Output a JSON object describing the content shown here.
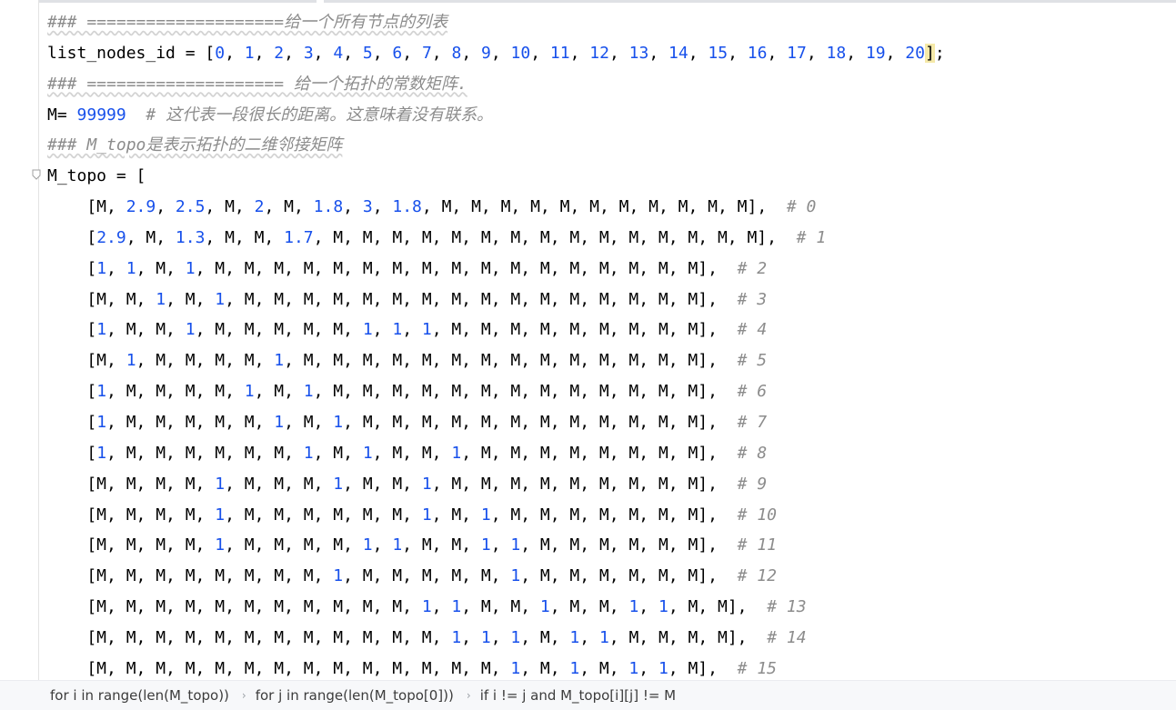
{
  "code_lines": [
    [
      {
        "t": "### ====================给一个所有节点的列表",
        "c": "comment"
      }
    ],
    [
      {
        "t": "list_nodes_id = ["
      },
      {
        "t": "0",
        "c": "num"
      },
      {
        "t": ", "
      },
      {
        "t": "1",
        "c": "num"
      },
      {
        "t": ", "
      },
      {
        "t": "2",
        "c": "num"
      },
      {
        "t": ", "
      },
      {
        "t": "3",
        "c": "num"
      },
      {
        "t": ", "
      },
      {
        "t": "4",
        "c": "num"
      },
      {
        "t": ", "
      },
      {
        "t": "5",
        "c": "num"
      },
      {
        "t": ", "
      },
      {
        "t": "6",
        "c": "num"
      },
      {
        "t": ", "
      },
      {
        "t": "7",
        "c": "num"
      },
      {
        "t": ", "
      },
      {
        "t": "8",
        "c": "num"
      },
      {
        "t": ", "
      },
      {
        "t": "9",
        "c": "num"
      },
      {
        "t": ", "
      },
      {
        "t": "10",
        "c": "num"
      },
      {
        "t": ", "
      },
      {
        "t": "11",
        "c": "num"
      },
      {
        "t": ", "
      },
      {
        "t": "12",
        "c": "num"
      },
      {
        "t": ", "
      },
      {
        "t": "13",
        "c": "num"
      },
      {
        "t": ", "
      },
      {
        "t": "14",
        "c": "num"
      },
      {
        "t": ", "
      },
      {
        "t": "15",
        "c": "num"
      },
      {
        "t": ", "
      },
      {
        "t": "16",
        "c": "num"
      },
      {
        "t": ", "
      },
      {
        "t": "17",
        "c": "num"
      },
      {
        "t": ", "
      },
      {
        "t": "18",
        "c": "num"
      },
      {
        "t": ", "
      },
      {
        "t": "19",
        "c": "num"
      },
      {
        "t": ", "
      },
      {
        "t": "20",
        "c": "num"
      },
      {
        "t": "]",
        "c": "bracket-hl"
      },
      {
        "t": ";"
      }
    ],
    [
      {
        "t": "### ==================== 给一个拓扑的常数矩阵.",
        "c": "comment"
      }
    ],
    [
      {
        "t": "M= "
      },
      {
        "t": "99999",
        "c": "num"
      },
      {
        "t": "  "
      },
      {
        "t": "# 这代表一段很长的距离。这意味着没有联系。",
        "c": "comment"
      }
    ],
    [
      {
        "t": "### M_topo是表示拓扑的二维邻接矩阵",
        "c": "comment"
      }
    ],
    [
      {
        "t": "M_topo = ["
      }
    ],
    [
      {
        "t": "    [M, "
      },
      {
        "t": "2.9",
        "c": "num"
      },
      {
        "t": ", "
      },
      {
        "t": "2.5",
        "c": "num"
      },
      {
        "t": ", M, "
      },
      {
        "t": "2",
        "c": "num"
      },
      {
        "t": ", M, "
      },
      {
        "t": "1.8",
        "c": "num"
      },
      {
        "t": ", "
      },
      {
        "t": "3",
        "c": "num"
      },
      {
        "t": ", "
      },
      {
        "t": "1.8",
        "c": "num"
      },
      {
        "t": ", M, M, M, M, M, M, M, M, M, M, M],  "
      },
      {
        "t": "# 0",
        "c": "comment"
      }
    ],
    [
      {
        "t": "    ["
      },
      {
        "t": "2.9",
        "c": "num"
      },
      {
        "t": ", M, "
      },
      {
        "t": "1.3",
        "c": "num"
      },
      {
        "t": ", M, M, "
      },
      {
        "t": "1.7",
        "c": "num"
      },
      {
        "t": ", M, M, M, M, M, M, M, M, M, M, M, M, M, M, M],  "
      },
      {
        "t": "# 1",
        "c": "comment"
      }
    ],
    [
      {
        "t": "    ["
      },
      {
        "t": "1",
        "c": "num"
      },
      {
        "t": ", "
      },
      {
        "t": "1",
        "c": "num"
      },
      {
        "t": ", M, "
      },
      {
        "t": "1",
        "c": "num"
      },
      {
        "t": ", M, M, M, M, M, M, M, M, M, M, M, M, M, M, M, M, M],  "
      },
      {
        "t": "# 2",
        "c": "comment"
      }
    ],
    [
      {
        "t": "    [M, M, "
      },
      {
        "t": "1",
        "c": "num"
      },
      {
        "t": ", M, "
      },
      {
        "t": "1",
        "c": "num"
      },
      {
        "t": ", M, M, M, M, M, M, M, M, M, M, M, M, M, M, M, M],  "
      },
      {
        "t": "# 3",
        "c": "comment"
      }
    ],
    [
      {
        "t": "    ["
      },
      {
        "t": "1",
        "c": "num"
      },
      {
        "t": ", M, M, "
      },
      {
        "t": "1",
        "c": "num"
      },
      {
        "t": ", M, M, M, M, M, "
      },
      {
        "t": "1",
        "c": "num"
      },
      {
        "t": ", "
      },
      {
        "t": "1",
        "c": "num"
      },
      {
        "t": ", "
      },
      {
        "t": "1",
        "c": "num"
      },
      {
        "t": ", M, M, M, M, M, M, M, M, M],  "
      },
      {
        "t": "# 4",
        "c": "comment"
      }
    ],
    [
      {
        "t": "    [M, "
      },
      {
        "t": "1",
        "c": "num"
      },
      {
        "t": ", M, M, M, M, "
      },
      {
        "t": "1",
        "c": "num"
      },
      {
        "t": ", M, M, M, M, M, M, M, M, M, M, M, M, M, M],  "
      },
      {
        "t": "# 5",
        "c": "comment"
      }
    ],
    [
      {
        "t": "    ["
      },
      {
        "t": "1",
        "c": "num"
      },
      {
        "t": ", M, M, M, M, "
      },
      {
        "t": "1",
        "c": "num"
      },
      {
        "t": ", M, "
      },
      {
        "t": "1",
        "c": "num"
      },
      {
        "t": ", M, M, M, M, M, M, M, M, M, M, M, M, M],  "
      },
      {
        "t": "# 6",
        "c": "comment"
      }
    ],
    [
      {
        "t": "    ["
      },
      {
        "t": "1",
        "c": "num"
      },
      {
        "t": ", M, M, M, M, M, "
      },
      {
        "t": "1",
        "c": "num"
      },
      {
        "t": ", M, "
      },
      {
        "t": "1",
        "c": "num"
      },
      {
        "t": ", M, M, M, M, M, M, M, M, M, M, M, M],  "
      },
      {
        "t": "# 7",
        "c": "comment"
      }
    ],
    [
      {
        "t": "    ["
      },
      {
        "t": "1",
        "c": "num"
      },
      {
        "t": ", M, M, M, M, M, M, "
      },
      {
        "t": "1",
        "c": "num"
      },
      {
        "t": ", M, "
      },
      {
        "t": "1",
        "c": "num"
      },
      {
        "t": ", M, M, "
      },
      {
        "t": "1",
        "c": "num"
      },
      {
        "t": ", M, M, M, M, M, M, M, M],  "
      },
      {
        "t": "# 8",
        "c": "comment"
      }
    ],
    [
      {
        "t": "    [M, M, M, M, "
      },
      {
        "t": "1",
        "c": "num"
      },
      {
        "t": ", M, M, M, "
      },
      {
        "t": "1",
        "c": "num"
      },
      {
        "t": ", M, M, "
      },
      {
        "t": "1",
        "c": "num"
      },
      {
        "t": ", M, M, M, M, M, M, M, M, M],  "
      },
      {
        "t": "# 9",
        "c": "comment"
      }
    ],
    [
      {
        "t": "    [M, M, M, M, "
      },
      {
        "t": "1",
        "c": "num"
      },
      {
        "t": ", M, M, M, M, M, M, "
      },
      {
        "t": "1",
        "c": "num"
      },
      {
        "t": ", M, "
      },
      {
        "t": "1",
        "c": "num"
      },
      {
        "t": ", M, M, M, M, M, M, M],  "
      },
      {
        "t": "# 10",
        "c": "comment"
      }
    ],
    [
      {
        "t": "    [M, M, M, M, "
      },
      {
        "t": "1",
        "c": "num"
      },
      {
        "t": ", M, M, M, M, "
      },
      {
        "t": "1",
        "c": "num"
      },
      {
        "t": ", "
      },
      {
        "t": "1",
        "c": "num"
      },
      {
        "t": ", M, M, "
      },
      {
        "t": "1",
        "c": "num"
      },
      {
        "t": ", "
      },
      {
        "t": "1",
        "c": "num"
      },
      {
        "t": ", M, M, M, M, M, M],  "
      },
      {
        "t": "# 11",
        "c": "comment"
      }
    ],
    [
      {
        "t": "    [M, M, M, M, M, M, M, M, "
      },
      {
        "t": "1",
        "c": "num"
      },
      {
        "t": ", M, M, M, M, M, "
      },
      {
        "t": "1",
        "c": "num"
      },
      {
        "t": ", M, M, M, M, M, M],  "
      },
      {
        "t": "# 12",
        "c": "comment"
      }
    ],
    [
      {
        "t": "    [M, M, M, M, M, M, M, M, M, M, M, "
      },
      {
        "t": "1",
        "c": "num"
      },
      {
        "t": ", "
      },
      {
        "t": "1",
        "c": "num"
      },
      {
        "t": ", M, M, "
      },
      {
        "t": "1",
        "c": "num"
      },
      {
        "t": ", M, M, "
      },
      {
        "t": "1",
        "c": "num"
      },
      {
        "t": ", "
      },
      {
        "t": "1",
        "c": "num"
      },
      {
        "t": ", M, M],  "
      },
      {
        "t": "# 13",
        "c": "comment"
      }
    ],
    [
      {
        "t": "    [M, M, M, M, M, M, M, M, M, M, M, M, "
      },
      {
        "t": "1",
        "c": "num"
      },
      {
        "t": ", "
      },
      {
        "t": "1",
        "c": "num"
      },
      {
        "t": ", "
      },
      {
        "t": "1",
        "c": "num"
      },
      {
        "t": ", M, "
      },
      {
        "t": "1",
        "c": "num"
      },
      {
        "t": ", "
      },
      {
        "t": "1",
        "c": "num"
      },
      {
        "t": ", M, M, M, M],  "
      },
      {
        "t": "# 14",
        "c": "comment"
      }
    ],
    [
      {
        "t": "    [M, M, M, M, M, M, M, M, M, M, M, M, M, M, "
      },
      {
        "t": "1",
        "c": "num"
      },
      {
        "t": ", M, "
      },
      {
        "t": "1",
        "c": "num"
      },
      {
        "t": ", M, "
      },
      {
        "t": "1",
        "c": "num"
      },
      {
        "t": ", "
      },
      {
        "t": "1",
        "c": "num"
      },
      {
        "t": ", M],  "
      },
      {
        "t": "# 15",
        "c": "comment"
      }
    ]
  ],
  "breadcrumbs": [
    "for i in range(len(M_topo))",
    "for j in range(len(M_topo[0]))",
    "if i != j and M_topo[i][j] != M"
  ]
}
